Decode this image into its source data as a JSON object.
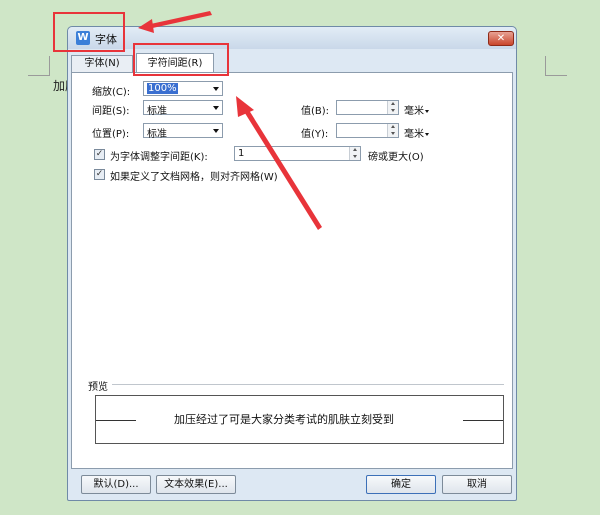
{
  "background": {
    "doc_text": "加压"
  },
  "dialog": {
    "icon_label": "W",
    "title": "字体",
    "close_glyph": "✕",
    "tabs": [
      {
        "label": "字体(N)"
      },
      {
        "label": "字符间距(R)"
      }
    ],
    "scale": {
      "label": "缩放(C):",
      "value": "100%"
    },
    "spacing": {
      "label": "间距(S):",
      "value": "标准",
      "amount_label": "值(B):",
      "amount_value": "",
      "unit": "毫米"
    },
    "position": {
      "label": "位置(P):",
      "value": "标准",
      "amount_label": "值(Y):",
      "amount_value": "",
      "unit": "毫米"
    },
    "kerning": {
      "label": "为字体调整字间距(K):",
      "checked": true,
      "value": "1",
      "suffix": "磅或更大(O)"
    },
    "grid": {
      "label": "如果定义了文档网格，则对齐网格(W)",
      "checked": true
    },
    "preview": {
      "label": "预览",
      "text": "加压经过了可是大家分类考试的肌肤立刻受到"
    },
    "buttons": {
      "default": "默认(D)...",
      "text_effects": "文本效果(E)...",
      "ok": "确定",
      "cancel": "取消"
    }
  },
  "annotation_color": "#e8343a"
}
